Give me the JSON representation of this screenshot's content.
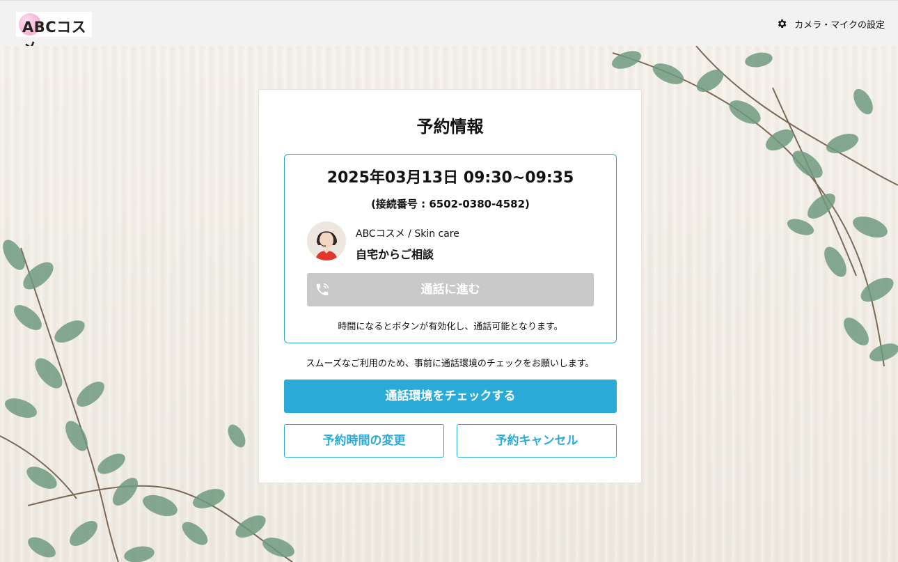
{
  "header": {
    "logo_text": "ABCコスメ",
    "settings_label": "カメラ・マイクの設定"
  },
  "card": {
    "title": "予約情報",
    "datetime": "2025年03月13日 09:30~09:35",
    "connection": "(接続番号 : 6502-0380-4582)",
    "store": "ABCコスメ / Skin care",
    "mode": "自宅からご相談",
    "call_button": "通話に進む",
    "call_note": "時間になるとボタンが有効化し、通話可能となります。",
    "check_note": "スムーズなご利用のため、事前に通話環境のチェックをお願いします。",
    "check_button": "通話環境をチェックする",
    "change_button": "予約時間の変更",
    "cancel_button": "予約キャンセル"
  },
  "colors": {
    "accent": "#2aabd7",
    "disabled": "#c9c9c9"
  }
}
